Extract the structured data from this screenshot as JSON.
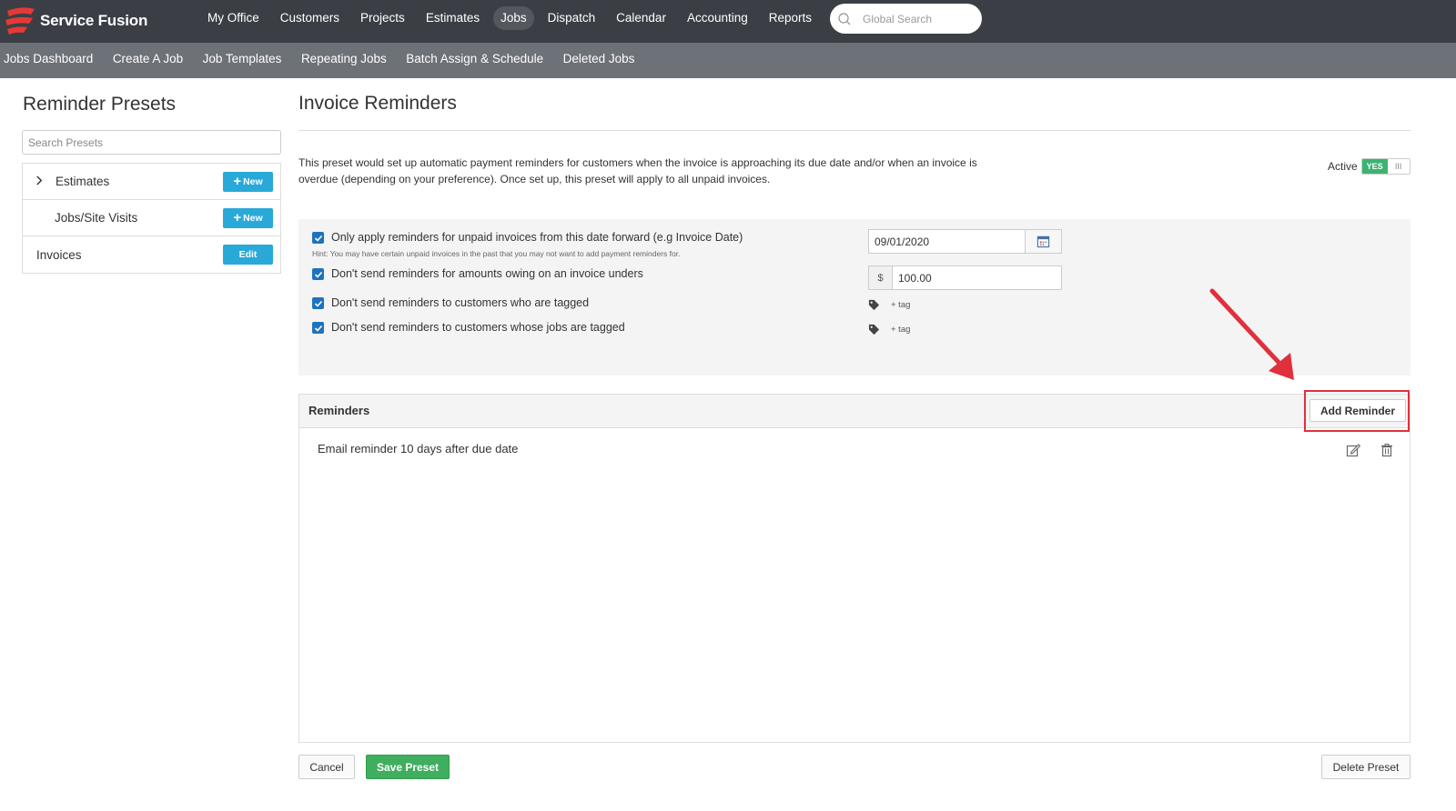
{
  "app": {
    "brand": "Service Fusion"
  },
  "topnav": {
    "items": [
      "My Office",
      "Customers",
      "Projects",
      "Estimates",
      "Jobs",
      "Dispatch",
      "Calendar",
      "Accounting",
      "Reports"
    ],
    "active": "Jobs",
    "search_placeholder": "Global Search"
  },
  "subnav": {
    "items": [
      "Jobs Dashboard",
      "Create A Job",
      "Job Templates",
      "Repeating Jobs",
      "Batch Assign & Schedule",
      "Deleted Jobs"
    ]
  },
  "left": {
    "title": "Reminder Presets",
    "search_placeholder": "Search Presets",
    "presets": [
      {
        "label": "Estimates",
        "button": "New"
      },
      {
        "label": "Jobs/Site Visits",
        "button": "New"
      },
      {
        "label": "Invoices",
        "button": "Edit"
      }
    ]
  },
  "main": {
    "title": "Invoice Reminders",
    "description": "This preset would set up automatic payment reminders for customers when the invoice is approaching its due date and/or when an invoice is overdue (depending on your preference). Once set up, this preset will apply to all unpaid invoices.",
    "active_label": "Active",
    "toggle_on": "YES",
    "toggle_off": "III",
    "options": {
      "date_forward": "Only apply reminders for unpaid invoices from this date forward (e.g Invoice Date)",
      "date_hint": "Hint: You may have certain unpaid invoices in the past that you may not want to add payment reminders for.",
      "amount_under": "Don't send reminders for amounts owing on an invoice unders",
      "customers_tagged": "Don't send reminders to customers who are tagged",
      "jobs_tagged": "Don't send reminders to customers whose jobs are tagged"
    },
    "date_value": "09/01/2020",
    "currency": "$",
    "amount_value": "100.00",
    "tag_label": "+ tag"
  },
  "reminders": {
    "title": "Reminders",
    "add_button": "Add Reminder",
    "items": [
      "Email reminder 10 days after due date"
    ]
  },
  "footer": {
    "cancel": "Cancel",
    "save": "Save Preset",
    "delete": "Delete Preset"
  },
  "colors": {
    "topbar": "#3b3f45",
    "subbar": "#6d7178",
    "accent_blue": "#29a9d7",
    "save_green": "#3fae5f",
    "highlight_red": "#e0303d"
  }
}
